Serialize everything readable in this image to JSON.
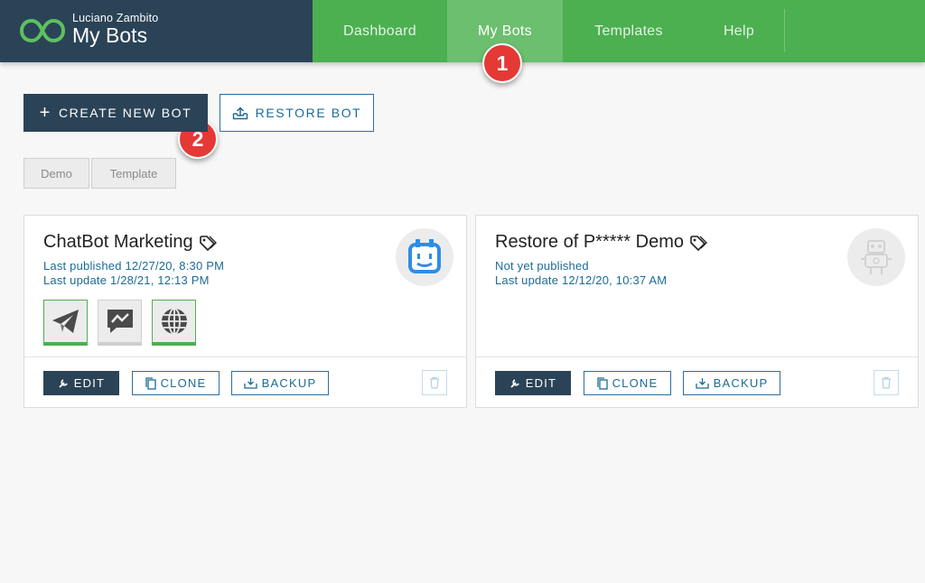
{
  "header": {
    "user": "Luciano Zambito",
    "title": "My Bots",
    "nav": [
      {
        "label": "Dashboard",
        "active": false
      },
      {
        "label": "My Bots",
        "active": true
      },
      {
        "label": "Templates",
        "active": false
      },
      {
        "label": "Help",
        "active": false
      }
    ]
  },
  "annotations": [
    "1",
    "2"
  ],
  "actions": {
    "create_label": "CREATE NEW BOT",
    "restore_label": "RESTORE BOT"
  },
  "filters": [
    "Demo",
    "Template"
  ],
  "cards": [
    {
      "title": "ChatBot Marketing",
      "line1": "Last published 12/27/20, 8:30 PM",
      "line2": "Last update 1/28/21, 12:13 PM",
      "avatar_icon": "robot-face-icon",
      "channels": [
        {
          "icon": "telegram-icon",
          "enabled": true
        },
        {
          "icon": "messenger-icon",
          "enabled": false
        },
        {
          "icon": "globe-icon",
          "enabled": true
        }
      ]
    },
    {
      "title": "Restore of P***** Demo",
      "line1": "Not yet published",
      "line2": "Last update 12/12/20, 10:37 AM",
      "avatar_icon": "robot-icon",
      "channels": []
    }
  ],
  "card_actions": {
    "edit": "EDIT",
    "clone": "CLONE",
    "backup": "BACKUP"
  },
  "colors": {
    "brand_dark": "#2b4357",
    "nav_green": "#4caf50",
    "nav_active": "#6cbf6f",
    "link_blue": "#1b6b96",
    "badge_red": "#e53935"
  }
}
